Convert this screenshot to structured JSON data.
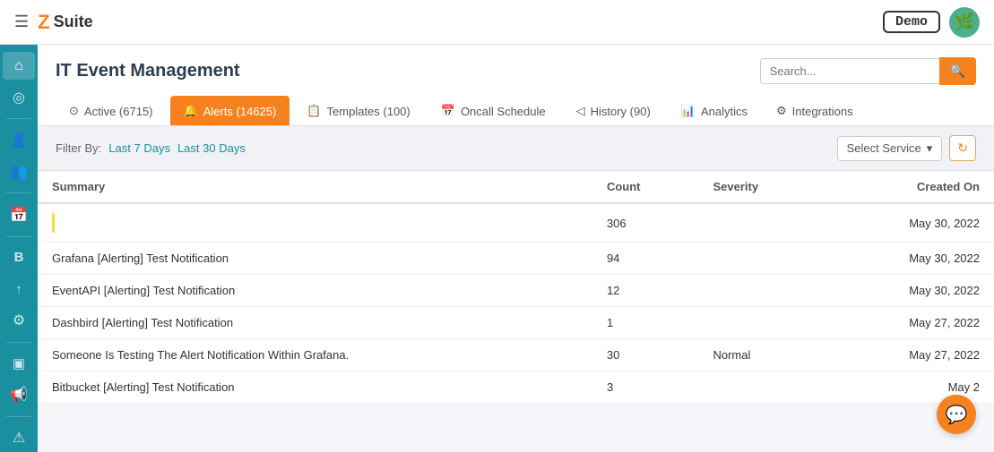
{
  "app": {
    "title": "Z Suite",
    "logo_letter": "Z",
    "logo_word": "Suite"
  },
  "topnav": {
    "hamburger": "☰",
    "demo_label": "Demo",
    "avatar_emoji": "🌿"
  },
  "sidebar": {
    "items": [
      {
        "id": "home",
        "icon": "⌂",
        "label": "Home"
      },
      {
        "id": "location",
        "icon": "◎",
        "label": "Location"
      },
      {
        "id": "users",
        "icon": "👤",
        "label": "Users"
      },
      {
        "id": "team",
        "icon": "👥",
        "label": "Team"
      },
      {
        "id": "calendar",
        "icon": "📅",
        "label": "Calendar"
      },
      {
        "id": "board",
        "icon": "B",
        "label": "Board"
      },
      {
        "id": "upload",
        "icon": "↑",
        "label": "Upload"
      },
      {
        "id": "settings",
        "icon": "⚙",
        "label": "Settings"
      },
      {
        "id": "chat",
        "icon": "▣",
        "label": "Chat"
      },
      {
        "id": "announce",
        "icon": "📢",
        "label": "Announce"
      },
      {
        "id": "alert",
        "icon": "⚠",
        "label": "Alert"
      }
    ]
  },
  "page": {
    "title": "IT Event Management",
    "search_placeholder": "Search..."
  },
  "tabs": [
    {
      "id": "active",
      "icon": "⊙",
      "label": "Active (6715)",
      "active": false
    },
    {
      "id": "alerts",
      "icon": "🔔",
      "label": "Alerts (14625)",
      "active": true
    },
    {
      "id": "templates",
      "icon": "📋",
      "label": "Templates (100)",
      "active": false
    },
    {
      "id": "oncall",
      "icon": "📅",
      "label": "Oncall Schedule",
      "active": false
    },
    {
      "id": "history",
      "icon": "◁",
      "label": "History (90)",
      "active": false
    },
    {
      "id": "analytics",
      "icon": "📊",
      "label": "Analytics",
      "active": false
    },
    {
      "id": "integrations",
      "icon": "⚙",
      "label": "Integrations",
      "active": false
    }
  ],
  "filter": {
    "label": "Filter By:",
    "options": [
      {
        "id": "7days",
        "label": "Last 7 Days"
      },
      {
        "id": "30days",
        "label": "Last 30 Days"
      }
    ],
    "select_service_label": "Select Service",
    "select_service_arrow": "▾"
  },
  "table": {
    "headers": [
      {
        "id": "summary",
        "label": "Summary"
      },
      {
        "id": "count",
        "label": "Count"
      },
      {
        "id": "severity",
        "label": "Severity"
      },
      {
        "id": "created_on",
        "label": "Created On"
      }
    ],
    "rows": [
      {
        "summary": "",
        "count": "306",
        "severity": "",
        "created_on": "May 30, 2022",
        "is_link": false,
        "has_marker": true
      },
      {
        "summary": "Grafana [Alerting] Test Notification",
        "count": "94",
        "severity": "",
        "created_on": "May 30, 2022",
        "is_link": true,
        "has_marker": false
      },
      {
        "summary": "EventAPI [Alerting] Test Notification",
        "count": "12",
        "severity": "",
        "created_on": "May 30, 2022",
        "is_link": true,
        "has_marker": false
      },
      {
        "summary": "Dashbird [Alerting] Test Notification",
        "count": "1",
        "severity": "",
        "created_on": "May 27, 2022",
        "is_link": true,
        "has_marker": false
      },
      {
        "summary": "Someone Is Testing The Alert Notification Within Grafana.",
        "count": "30",
        "severity": "Normal",
        "created_on": "May 27, 2022",
        "is_link": true,
        "has_marker": false
      },
      {
        "summary": "Bitbucket [Alerting] Test Notification",
        "count": "3",
        "severity": "",
        "created_on": "May 2",
        "is_link": true,
        "has_marker": false
      }
    ]
  }
}
